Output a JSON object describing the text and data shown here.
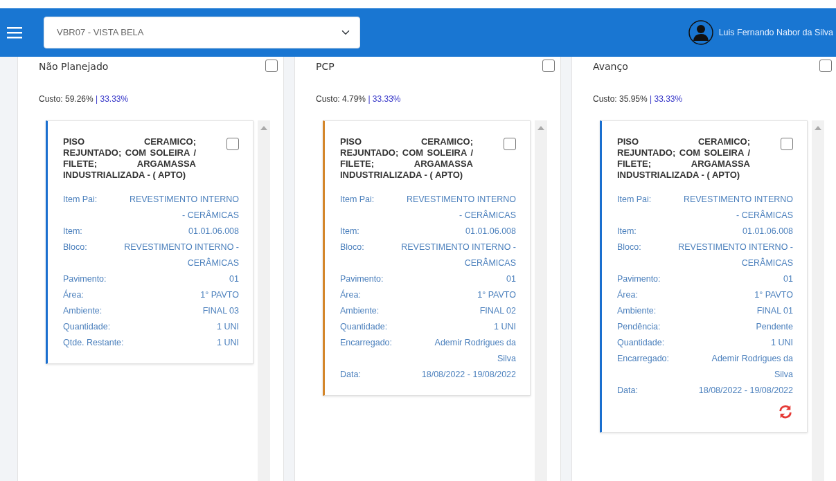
{
  "header": {
    "project_select": {
      "value": "VBR07 - VISTA BELA"
    },
    "user_name": "Luis Fernando Nabor da Silva"
  },
  "columns": [
    {
      "title": "Não Planejado",
      "checked": false,
      "cost": "Custo: 59.26%",
      "share": "| 33.33%",
      "cards": [
        {
          "title": "PISO CERAMICO; REJUNTADO; COM SOLEIRA / FILETE; ARGAMASSA INDUSTRIALIZADA - ( APTO)",
          "color": "#1a6fcf",
          "checked": false,
          "refresh": false,
          "fields": [
            {
              "label": "Item Pai:",
              "value": "REVESTIMENTO INTERNO - CERÂMICAS"
            },
            {
              "label": "Item:",
              "value": "01.01.06.008"
            },
            {
              "label": "Bloco:",
              "value": "REVESTIMENTO INTERNO - CERÂMICAS"
            },
            {
              "label": "Pavimento:",
              "value": "01"
            },
            {
              "label": "Área:",
              "value": "1° PAVTO"
            },
            {
              "label": "Ambiente:",
              "value": "FINAL 03"
            },
            {
              "label": "Quantidade:",
              "value": "1 UNI"
            },
            {
              "label": "Qtde. Restante:",
              "value": "1 UNI"
            }
          ]
        }
      ]
    },
    {
      "title": "PCP",
      "checked": false,
      "cost": "Custo: 4.79%",
      "share": "| 33.33%",
      "cards": [
        {
          "title": "PISO CERAMICO; REJUNTADO; COM SOLEIRA / FILETE; ARGAMASSA INDUSTRIALIZADA - ( APTO)",
          "color": "#d4862a",
          "checked": false,
          "refresh": false,
          "fields": [
            {
              "label": "Item Pai:",
              "value": "REVESTIMENTO INTERNO - CERÂMICAS"
            },
            {
              "label": "Item:",
              "value": "01.01.06.008"
            },
            {
              "label": "Bloco:",
              "value": "REVESTIMENTO INTERNO - CERÂMICAS"
            },
            {
              "label": "Pavimento:",
              "value": "01"
            },
            {
              "label": "Área:",
              "value": "1° PAVTO"
            },
            {
              "label": "Ambiente:",
              "value": "FINAL 02"
            },
            {
              "label": "Quantidade:",
              "value": "1 UNI"
            },
            {
              "label": "Encarregado:",
              "value": "Ademir Rodrigues da Silva"
            },
            {
              "label": "Data:",
              "value": "18/08/2022 - 19/08/2022"
            }
          ]
        }
      ]
    },
    {
      "title": "Avanço",
      "checked": false,
      "cost": "Custo: 35.95%",
      "share": "| 33.33%",
      "cards": [
        {
          "title": "PISO CERAMICO; REJUNTADO; COM SOLEIRA / FILETE; ARGAMASSA INDUSTRIALIZADA - ( APTO)",
          "color": "#1a6fcf",
          "checked": false,
          "refresh": true,
          "fields": [
            {
              "label": "Item Pai:",
              "value": "REVESTIMENTO INTERNO - CERÂMICAS"
            },
            {
              "label": "Item:",
              "value": "01.01.06.008"
            },
            {
              "label": "Bloco:",
              "value": "REVESTIMENTO INTERNO - CERÂMICAS"
            },
            {
              "label": "Pavimento:",
              "value": "01"
            },
            {
              "label": "Área:",
              "value": "1° PAVTO"
            },
            {
              "label": "Ambiente:",
              "value": "FINAL 01"
            },
            {
              "label": "Pendência:",
              "value": "Pendente"
            },
            {
              "label": "Quantidade:",
              "value": "1 UNI"
            },
            {
              "label": "Encarregado:",
              "value": "Ademir Rodrigues da Silva"
            },
            {
              "label": "Data:",
              "value": "18/08/2022 - 19/08/2022"
            }
          ]
        }
      ]
    }
  ]
}
